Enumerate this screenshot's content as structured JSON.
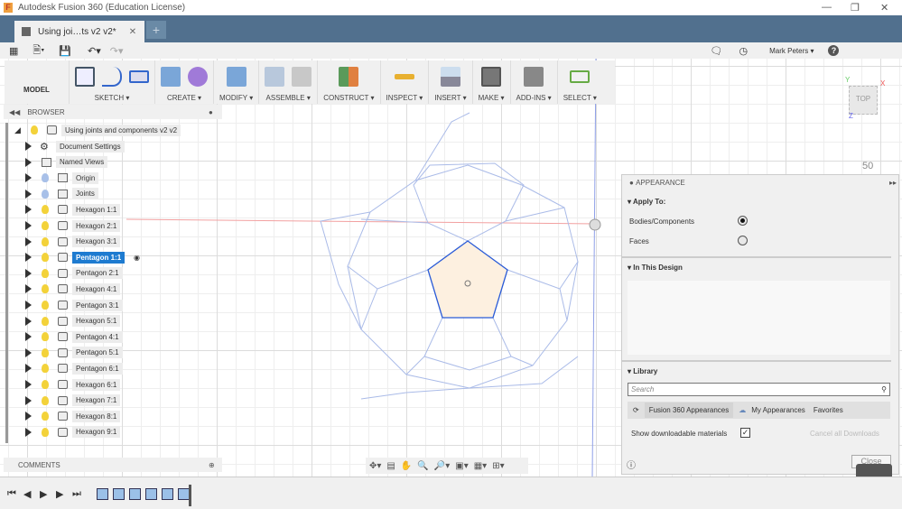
{
  "window": {
    "title": "Autodesk Fusion 360 (Education License)",
    "logo": "F"
  },
  "tab": {
    "title": "Using joi…ts v2 v2*",
    "new_tab": "+"
  },
  "user": {
    "name": "Mark Peters",
    "help": "?"
  },
  "toolbar": {
    "workspace": "MODEL",
    "groups": [
      "SKETCH",
      "CREATE",
      "MODIFY",
      "ASSEMBLE",
      "CONSTRUCT",
      "INSPECT",
      "INSERT",
      "MAKE",
      "ADD-INS",
      "SELECT"
    ]
  },
  "browser": {
    "title": "BROWSER",
    "root": "Using joints and components v2 v2",
    "items": [
      {
        "label": "Document Settings",
        "icon": "gear-icon",
        "bulb": "none"
      },
      {
        "label": "Named Views",
        "icon": "folder-icon",
        "bulb": "none"
      },
      {
        "label": "Origin",
        "icon": "folder-icon",
        "bulb": "blue"
      },
      {
        "label": "Joints",
        "icon": "folder-icon",
        "bulb": "blue"
      },
      {
        "label": "Hexagon 1:1",
        "icon": "component-icon",
        "bulb": "yellow"
      },
      {
        "label": "Hexagon 2:1",
        "icon": "component-icon",
        "bulb": "yellow"
      },
      {
        "label": "Hexagon 3:1",
        "icon": "component-icon",
        "bulb": "yellow"
      },
      {
        "label": "Pentagon 1:1",
        "icon": "component-icon",
        "bulb": "yellow",
        "selected": true
      },
      {
        "label": "Pentagon 2:1",
        "icon": "component-icon",
        "bulb": "yellow"
      },
      {
        "label": "Hexagon 4:1",
        "icon": "component-icon",
        "bulb": "yellow"
      },
      {
        "label": "Pentagon 3:1",
        "icon": "component-icon",
        "bulb": "yellow"
      },
      {
        "label": "Hexagon 5:1",
        "icon": "component-icon",
        "bulb": "yellow"
      },
      {
        "label": "Pentagon 4:1",
        "icon": "component-icon",
        "bulb": "yellow"
      },
      {
        "label": "Pentagon 5:1",
        "icon": "component-icon",
        "bulb": "yellow"
      },
      {
        "label": "Pentagon 6:1",
        "icon": "component-icon",
        "bulb": "yellow"
      },
      {
        "label": "Hexagon 6:1",
        "icon": "component-icon",
        "bulb": "yellow"
      },
      {
        "label": "Hexagon 7:1",
        "icon": "component-icon",
        "bulb": "yellow"
      },
      {
        "label": "Hexagon 8:1",
        "icon": "component-icon",
        "bulb": "yellow"
      },
      {
        "label": "Hexagon 9:1",
        "icon": "component-icon",
        "bulb": "yellow"
      }
    ]
  },
  "comments": {
    "title": "COMMENTS"
  },
  "viewcube": {
    "face": "TOP",
    "x": "X",
    "y": "Y",
    "z": "Z",
    "scale": "50"
  },
  "appearance": {
    "title": "APPEARANCE",
    "apply_to": "Apply To:",
    "bodies": "Bodies/Components",
    "faces": "Faces",
    "selected": "Bodies/Components",
    "in_design": "In This Design",
    "library": "Library",
    "search_placeholder": "Search",
    "tabs": [
      "Fusion 360 Appearances",
      "My Appearances",
      "Favorites"
    ],
    "show_downloadable": "Show downloadable materials",
    "show_downloadable_checked": true,
    "cancel_downloads": "Cancel all Downloads",
    "close": "Close"
  },
  "colors": {
    "tabbar": "#51708e",
    "selection": "#1e7bd0",
    "sketch_blue": "#2a5bd7",
    "face_fill": "#fdf0e0"
  }
}
